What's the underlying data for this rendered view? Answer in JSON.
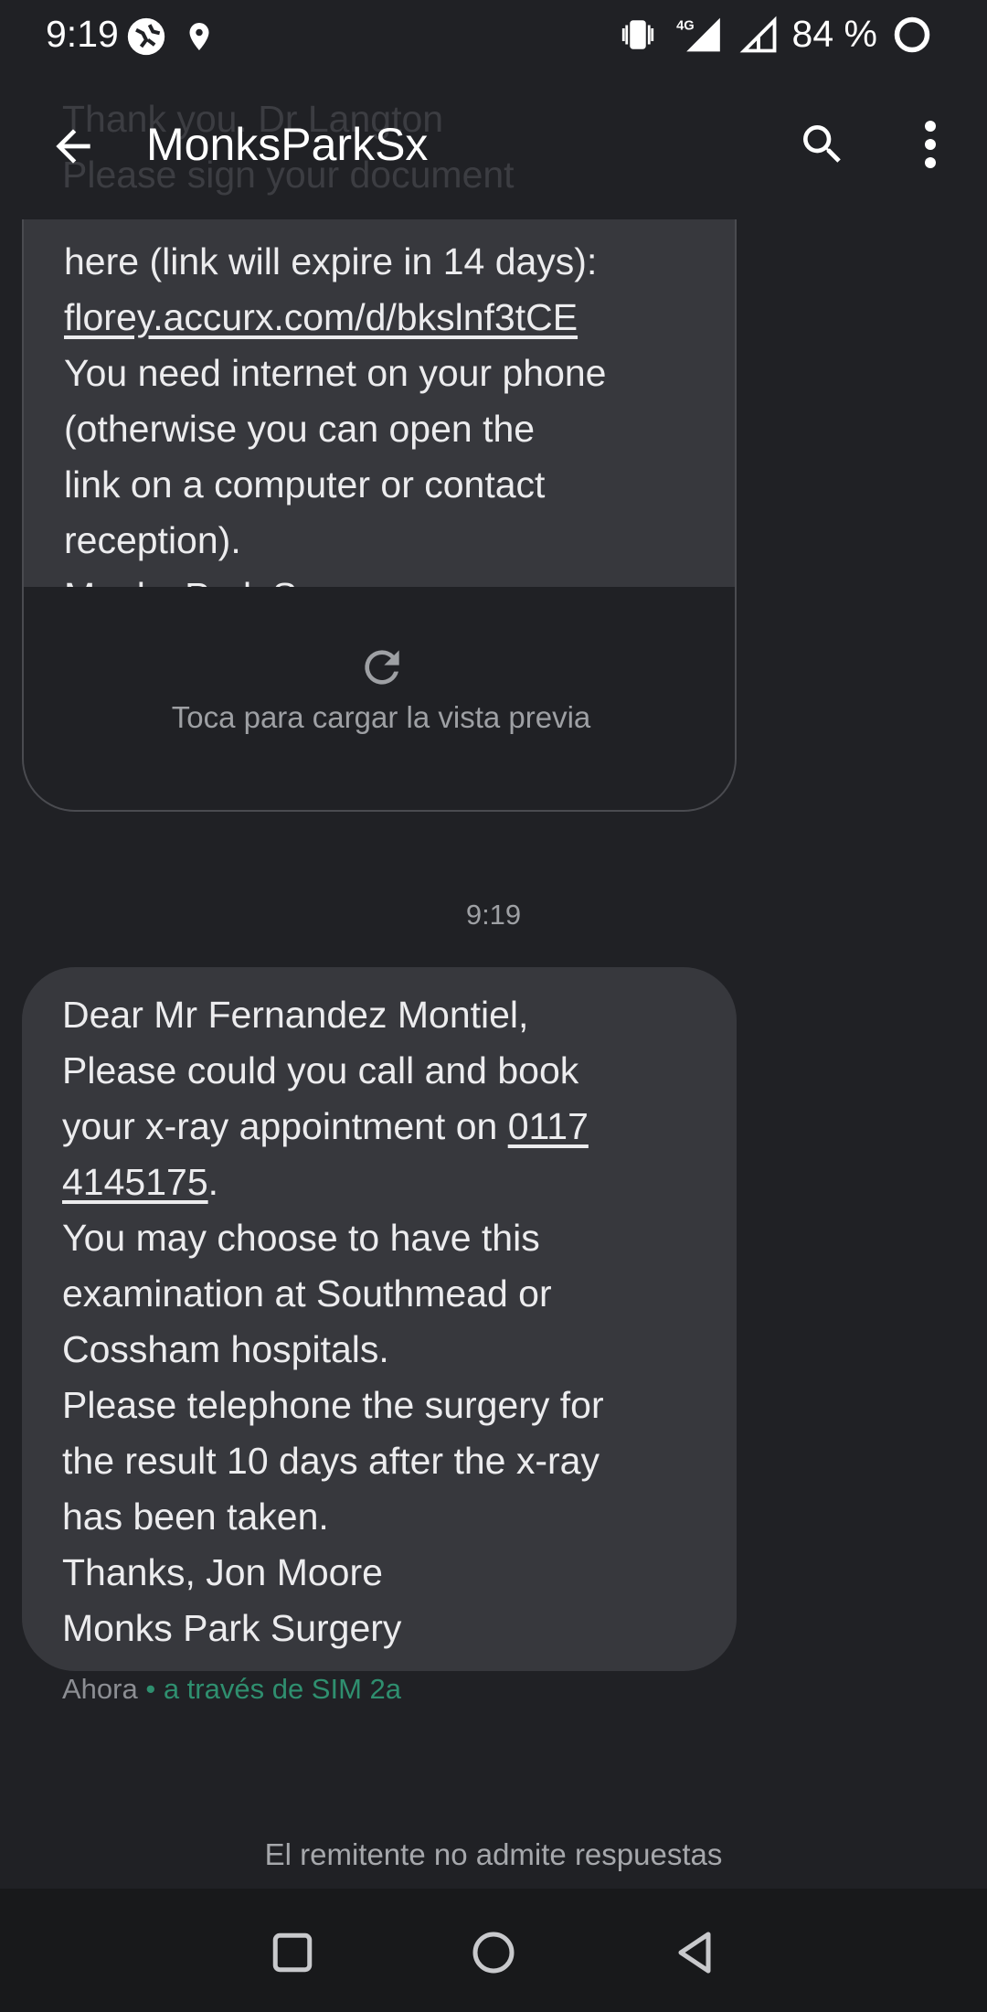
{
  "status_bar": {
    "time": "9:19",
    "network": "4G",
    "battery": "84 %",
    "icons": [
      "vpn-globe-icon",
      "location-icon",
      "vibrate-icon",
      "signal-4g-icon",
      "signal-icon",
      "battery-ring-icon"
    ]
  },
  "app_bar": {
    "title": "MonksParkSx",
    "ghost_lines": [
      "Thank you.",
      "Thank you. Dr Langton",
      "Please sign your document"
    ],
    "icons": [
      "back-arrow-icon",
      "search-icon",
      "more-vert-icon"
    ]
  },
  "messages": {
    "first": {
      "lines": [
        "here (link will expire in 14 days):",
        "florey.accurx.com/d/bkslnf3tCE",
        "You need internet on your phone",
        "(otherwise you can open the",
        "link on a computer or contact",
        "reception).",
        "Monks Park Surgery"
      ],
      "link": "florey.accurx.com/d/bkslnf3tCE",
      "preview_label": "Toca para cargar la vista previa"
    },
    "timestamp": "9:19",
    "second": {
      "line1": "Dear Mr Fernandez Montiel,",
      "line2": "Please could you call and book",
      "line3_prefix": "your x-ray appointment on ",
      "phone_part1": "0117",
      "phone_part2": "4145175",
      "line4_suffix": ".",
      "line5": "You may choose to have this",
      "line6": "examination at Southmead or",
      "line7": "Cossham hospitals.",
      "line8": "Please telephone the surgery for",
      "line9": "the result 10 days after the x-ray",
      "line10": "has been taken.",
      "line11": "Thanks, Jon Moore",
      "line12": "Monks Park Surgery"
    },
    "meta_time": "Ahora",
    "meta_sim": " • a través de SIM 2a"
  },
  "footer": {
    "no_reply": "El remitente no admite respuestas"
  },
  "nav": [
    "recents-square-icon",
    "home-circle-icon",
    "back-triangle-icon"
  ],
  "colors": {
    "background": "#202125",
    "bubble": "#37383d",
    "sim_label": "#2f8f6f",
    "nav_bar": "#18191b"
  }
}
